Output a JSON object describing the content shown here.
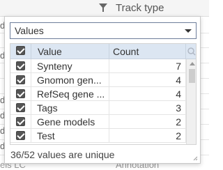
{
  "background": {
    "header_title": "Track type",
    "left_fragments": [
      "de",
      "d",
      "d",
      "de",
      "d",
      "d"
    ],
    "bottom_left": "els LC",
    "bottom_right": "Annotation"
  },
  "popup": {
    "select_value": "Values",
    "columns": {
      "value": "Value",
      "count": "Count"
    },
    "rows": [
      {
        "value": "Synteny",
        "count": "7",
        "checked": true
      },
      {
        "value": "Gnomon gen...",
        "count": "4",
        "checked": true
      },
      {
        "value": "RefSeq gene ...",
        "count": "4",
        "checked": true
      },
      {
        "value": "Tags",
        "count": "3",
        "checked": true
      },
      {
        "value": "Gene models",
        "count": "2",
        "checked": true
      },
      {
        "value": "Test",
        "count": "2",
        "checked": true
      }
    ],
    "footer": "36/52 values are unique"
  },
  "icons": {
    "filter": "filter-icon",
    "search": "search-icon",
    "caret": "chevron-down-icon",
    "scroll_up": "scroll-up-arrow-icon",
    "resize": "resize-grip-icon"
  }
}
